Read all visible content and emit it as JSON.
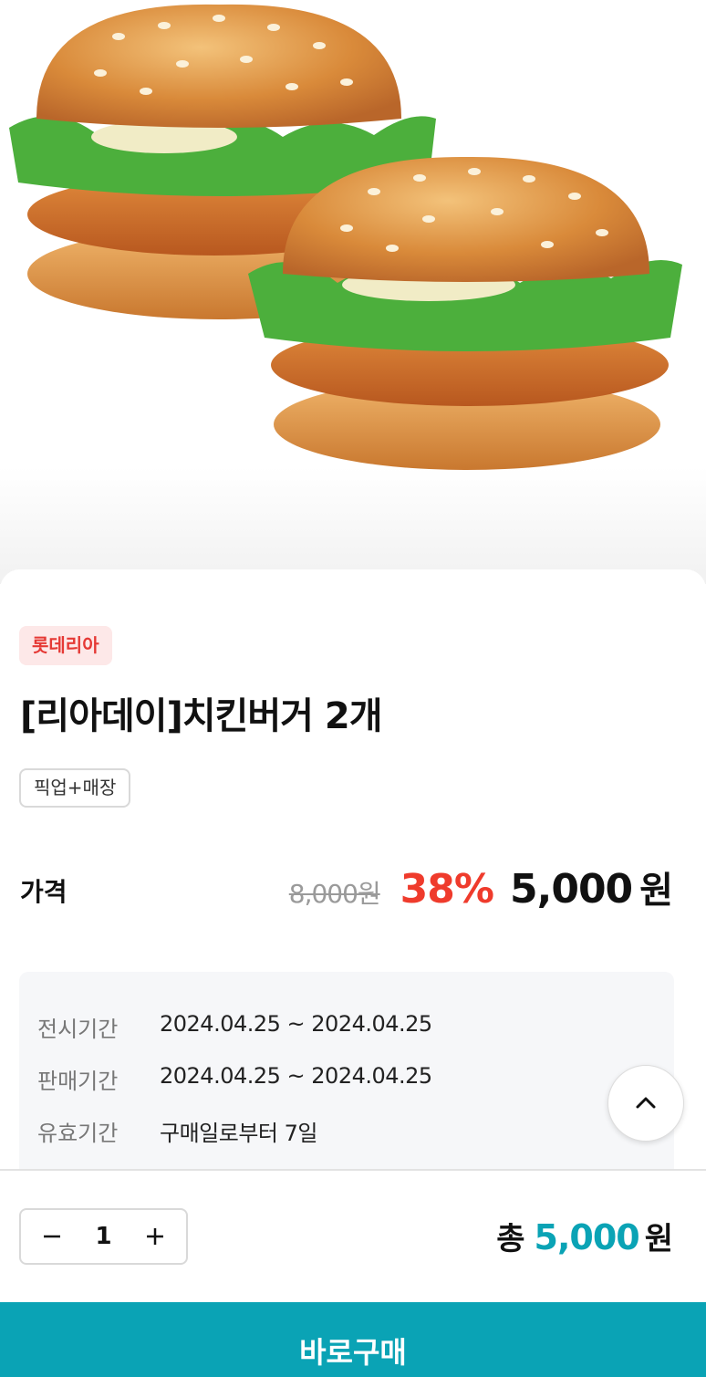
{
  "product": {
    "brand": "롯데리아",
    "title": "[리아데이]치킨버거 2개",
    "tag": "픽업+매장"
  },
  "price": {
    "label": "가격",
    "original": "8,000원",
    "discount_rate": "38%",
    "sale_amount": "5,000",
    "currency": "원"
  },
  "info": [
    {
      "key": "전시기간",
      "value": "2024.04.25 ~ 2024.04.25"
    },
    {
      "key": "판매기간",
      "value": "2024.04.25 ~ 2024.04.25"
    },
    {
      "key": "유효기간",
      "value": "구매일로부터 7일"
    }
  ],
  "order": {
    "quantity": "1",
    "total_label": "총",
    "total_amount": "5,000",
    "total_currency": "원",
    "buy_label": "바로구매"
  },
  "colors": {
    "accent": "#0aa3b5",
    "discount": "#ef3b2c",
    "brand_badge_bg": "#fde8e8"
  }
}
